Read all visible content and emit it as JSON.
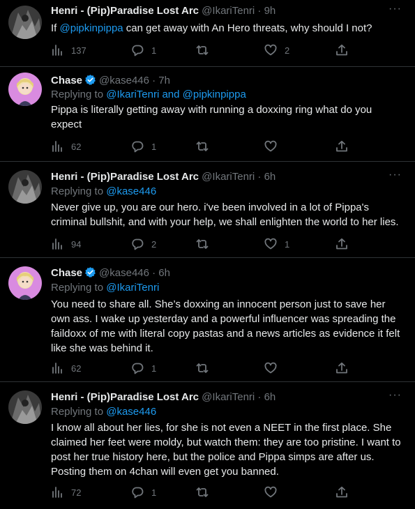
{
  "colors": {
    "background": "#000000",
    "text": "#e7e9ea",
    "muted": "#71767b",
    "link": "#1d9bf0",
    "verified": "#1d9bf0",
    "divider": "#2f3336"
  },
  "icons": {
    "views": "views-icon",
    "reply": "reply-icon",
    "retweet": "retweet-icon",
    "like": "like-icon",
    "share": "share-icon",
    "more": "more-icon",
    "verified": "verified-badge-icon"
  },
  "tweets": [
    {
      "display_name": "Henri - (Pip)Paradise Lost Arc",
      "meta": "@IkariTenri · 9h",
      "reply_prefix": "",
      "reply_mentions": "",
      "reply_and": "",
      "reply_mentions2": "",
      "text_pre": "If ",
      "text_mention": "@pipkinpippa",
      "text_post": " can get away with An Hero threats, why should I not?",
      "views": "137",
      "replies": "1",
      "retweets": "",
      "likes": "2"
    },
    {
      "display_name": "Chase",
      "meta": "@kase446 · 7h",
      "reply_prefix": "Replying to ",
      "reply_mentions": "@IkariTenri",
      "reply_and": " and ",
      "reply_mentions2": "@pipkinpippa",
      "text_pre": "Pippa is literally getting away with running a doxxing ring what do you expect",
      "text_mention": "",
      "text_post": "",
      "views": "62",
      "replies": "1",
      "retweets": "",
      "likes": ""
    },
    {
      "display_name": "Henri - (Pip)Paradise Lost Arc",
      "meta": "@IkariTenri · 6h",
      "reply_prefix": "Replying to ",
      "reply_mentions": "@kase446",
      "reply_and": "",
      "reply_mentions2": "",
      "text_pre": "Never give up, you are our hero. i've been involved in a lot of Pippa's criminal bullshit, and with your help, we shall enlighten the world to her lies.",
      "text_mention": "",
      "text_post": "",
      "views": "94",
      "replies": "2",
      "retweets": "",
      "likes": "1"
    },
    {
      "display_name": "Chase",
      "meta": "@kase446 · 6h",
      "reply_prefix": "Replying to ",
      "reply_mentions": "@IkariTenri",
      "reply_and": "",
      "reply_mentions2": "",
      "text_pre": "You need to share all. She’s doxxing an innocent person just to save her own ass. I wake up yesterday and a powerful influencer was spreading the faildoxx of me with literal copy pastas and a news articles as evidence it felt like she was behind it.",
      "text_mention": "",
      "text_post": "",
      "views": "62",
      "replies": "1",
      "retweets": "",
      "likes": ""
    },
    {
      "display_name": "Henri - (Pip)Paradise Lost Arc",
      "meta": "@IkariTenri · 6h",
      "reply_prefix": "Replying to ",
      "reply_mentions": "@kase446",
      "reply_and": "",
      "reply_mentions2": "",
      "text_pre": "I know all about her lies, for she is not even a NEET in the first place. She claimed her feet were moldy, but watch them: they are too pristine. I want to post her true history here, but the police and Pippa simps are after us. Posting them on 4chan will even get you banned.",
      "text_mention": "",
      "text_post": "",
      "views": "72",
      "replies": "1",
      "retweets": "",
      "likes": ""
    }
  ]
}
